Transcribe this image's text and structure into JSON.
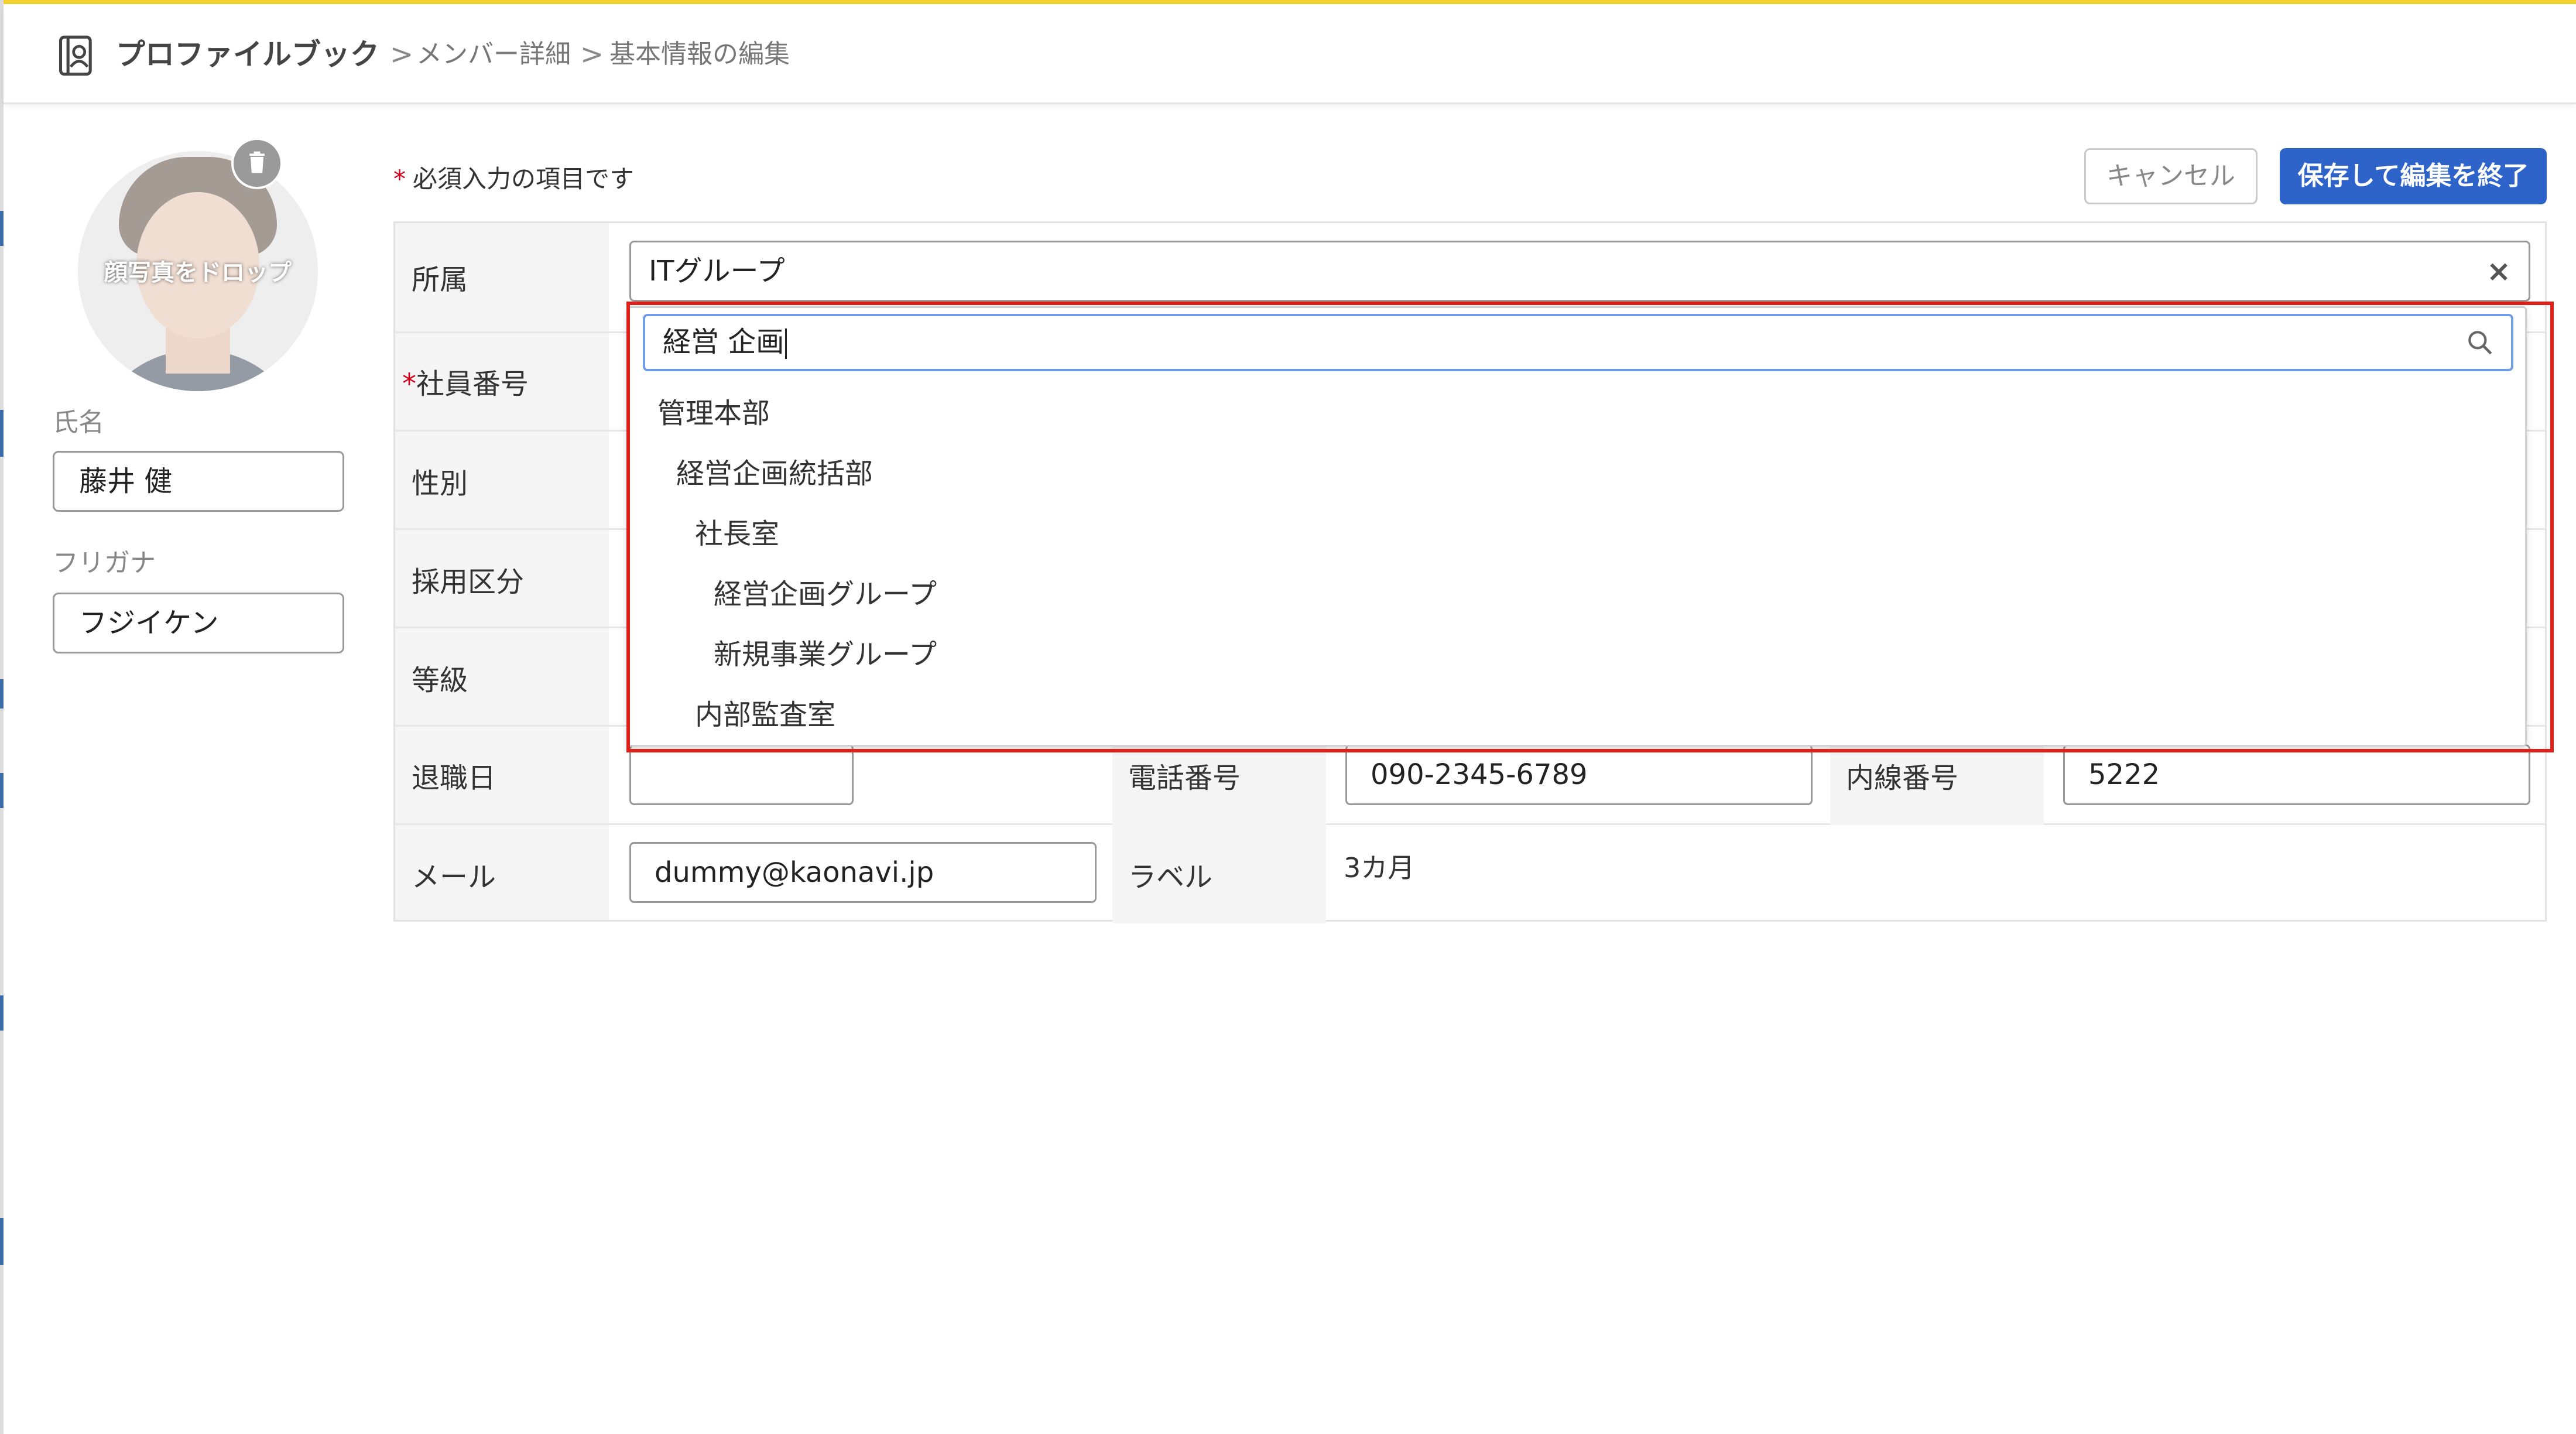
{
  "breadcrumb": {
    "root": "プロファイルブック",
    "sep": ">",
    "level1": "メンバー詳細",
    "level2": "基本情報の編集"
  },
  "profile": {
    "photo_drop_text": "顔写真をドロップ",
    "name_label": "氏名",
    "name_value": "藤井 健",
    "furigana_label": "フリガナ",
    "furigana_value": "フジイケン"
  },
  "form_header": {
    "required_star": "*",
    "required_note": "必須入力の項目です",
    "cancel_label": "キャンセル",
    "save_label": "保存して編集を終了"
  },
  "fields": {
    "affiliation_label": "所属",
    "affiliation_value": "ITグループ",
    "clear_symbol": "×",
    "employee_no_star": "*",
    "employee_no_label": "社員番号",
    "gender_label": "性別",
    "hiring_label": "採用区分",
    "grade_label": "等級",
    "retire_label": "退職日",
    "retire_value": "",
    "phone_label": "電話番号",
    "phone_value": "090-2345-6789",
    "extension_label": "内線番号",
    "extension_value": "5222",
    "mail_label": "メール",
    "mail_value": "dummy@kaonavi.jp",
    "tag_label": "ラベル",
    "tag_value": "3カ月"
  },
  "dropdown": {
    "search_value": "経営 企画",
    "items": [
      "管理本部",
      "経営企画統括部",
      "社長室",
      "経営企画グループ",
      "新規事業グループ",
      "内部監査室"
    ]
  },
  "colors": {
    "accent": "#2e64c9",
    "top_bar": "#f2cf2e",
    "highlight": "#e0201b",
    "required": "#d0021b"
  }
}
